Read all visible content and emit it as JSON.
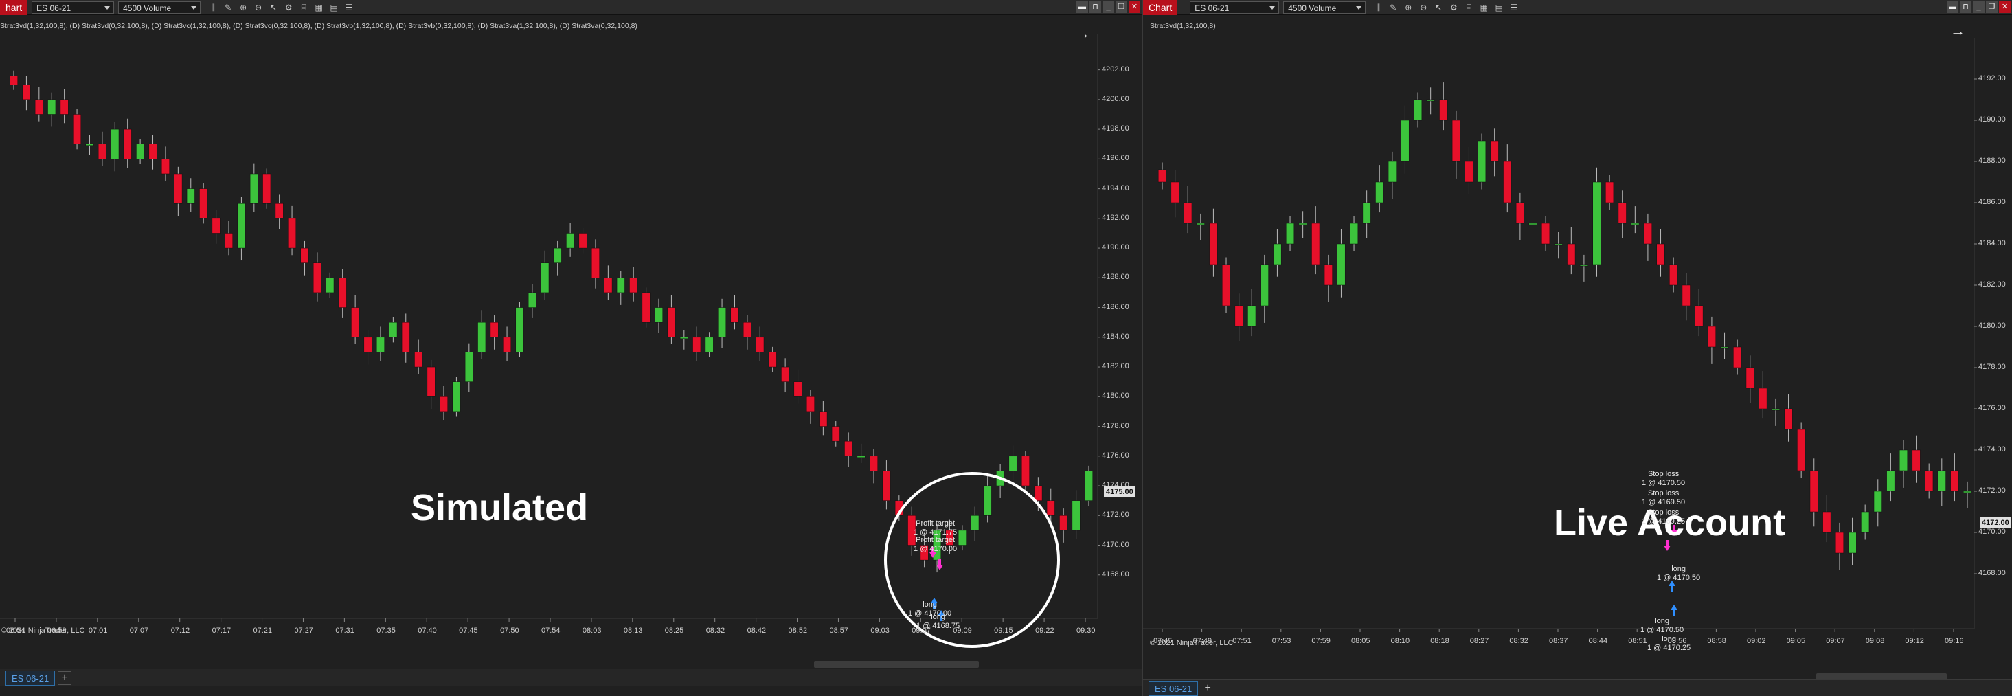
{
  "left": {
    "toolbar": {
      "chart_label": "hart",
      "instrument": "ES 06-21",
      "bar_type": "4500 Volume"
    },
    "indicators": "Strat3vd(1,32,100,8), (D) Strat3vd(0,32,100,8), (D) Strat3vc(1,32,100,8), (D) Strat3vc(0,32,100,8), (D) Strat3vb(1,32,100,8), (D) Strat3vb(0,32,100,8), (D) Strat3va(1,32,100,8), (D) Strat3va(0,32,100,8)",
    "price_labels": [
      "4202.00",
      "4200.00",
      "4198.00",
      "4196.00",
      "4194.00",
      "4192.00",
      "4190.00",
      "4188.00",
      "4186.00",
      "4184.00",
      "4182.00",
      "4180.00",
      "4178.00",
      "4176.00",
      "4174.00",
      "4172.00",
      "4170.00",
      "4168.00"
    ],
    "current_price": "4175.00",
    "time_labels": [
      "06:54",
      "06:58",
      "07:01",
      "07:07",
      "07:12",
      "07:17",
      "07:21",
      "07:27",
      "07:31",
      "07:35",
      "07:40",
      "07:45",
      "07:50",
      "07:54",
      "08:03",
      "08:13",
      "08:25",
      "08:32",
      "08:42",
      "08:52",
      "08:57",
      "09:03",
      "09:07",
      "09:09",
      "09:15",
      "09:22",
      "09:30"
    ],
    "copyright": "© 2021 NinjaTrader, LLC",
    "overlay_text": "Simulated",
    "annotations": [
      {
        "text": "Profit target\n1 @ 4171.75"
      },
      {
        "text": "Profit target\n1 @ 4170.00"
      },
      {
        "text": "long\n1 @ 4170.00"
      },
      {
        "text": "long\n1 @ 4168.75"
      }
    ],
    "tab_label": "ES 06-21",
    "add_tab": "+"
  },
  "right": {
    "toolbar": {
      "chart_label": "Chart",
      "instrument": "ES 06-21",
      "bar_type": "4500 Volume"
    },
    "indicators": "Strat3vd(1,32,100,8)",
    "price_labels": [
      "4192.00",
      "4190.00",
      "4188.00",
      "4186.00",
      "4184.00",
      "4182.00",
      "4180.00",
      "4178.00",
      "4176.00",
      "4174.00",
      "4172.00",
      "4170.00",
      "4168.00"
    ],
    "current_price": "4172.00",
    "time_labels": [
      "07:45",
      "07:49",
      "07:51",
      "07:53",
      "07:59",
      "08:05",
      "08:10",
      "08:18",
      "08:27",
      "08:32",
      "08:37",
      "08:44",
      "08:51",
      "08:56",
      "08:58",
      "09:02",
      "09:05",
      "09:07",
      "09:08",
      "09:12",
      "09:16"
    ],
    "copyright": "© 2021 NinjaTrader, LLC",
    "overlay_text": "Live Account",
    "annotations": [
      {
        "text": "Stop loss\n1 @ 4170.50"
      },
      {
        "text": "Stop loss\n1 @ 4169.50"
      },
      {
        "text": "Stop loss\n1 @ 4169.25"
      },
      {
        "text": "long\n1 @ 4170.50"
      },
      {
        "text": "long\n1 @ 4170.50"
      },
      {
        "text": "long\n1 @ 4170.25"
      }
    ],
    "tab_label": "ES 06-21",
    "add_tab": "+"
  },
  "colors": {
    "up": "#3cc43c",
    "down": "#e8102a",
    "background": "#202020",
    "entry_arrow": "#2f8fff",
    "exit_arrow": "#ff30d0"
  },
  "chart_data": [
    {
      "type": "candlestick",
      "title": "Simulated",
      "ylim": [
        4166,
        4203
      ],
      "close_series": [
        4201,
        4200,
        4199,
        4200,
        4199,
        4197,
        4197,
        4196,
        4198,
        4196,
        4197,
        4196,
        4195,
        4193,
        4194,
        4192,
        4191,
        4190,
        4193,
        4195,
        4193,
        4192,
        4190,
        4189,
        4187,
        4188,
        4186,
        4184,
        4183,
        4184,
        4185,
        4183,
        4182,
        4180,
        4179,
        4181,
        4183,
        4185,
        4184,
        4183,
        4186,
        4187,
        4189,
        4190,
        4191,
        4190,
        4188,
        4187,
        4188,
        4187,
        4185,
        4186,
        4184,
        4184,
        4183,
        4184,
        4186,
        4185,
        4184,
        4183,
        4182,
        4181,
        4180,
        4179,
        4178,
        4177,
        4176,
        4176,
        4175,
        4173,
        4172,
        4170,
        4169,
        4171,
        4170,
        4171,
        4172,
        4174,
        4175,
        4176,
        4174,
        4173,
        4172,
        4171,
        4173,
        4175
      ]
    },
    {
      "type": "candlestick",
      "title": "Live Account",
      "ylim": [
        4166,
        4193
      ],
      "close_series": [
        4187,
        4186,
        4185,
        4185,
        4183,
        4181,
        4180,
        4181,
        4183,
        4184,
        4185,
        4185,
        4183,
        4182,
        4184,
        4185,
        4186,
        4187,
        4188,
        4190,
        4191,
        4191,
        4190,
        4188,
        4187,
        4189,
        4188,
        4186,
        4185,
        4185,
        4184,
        4184,
        4183,
        4183,
        4187,
        4186,
        4185,
        4185,
        4184,
        4183,
        4182,
        4181,
        4180,
        4179,
        4179,
        4178,
        4177,
        4176,
        4176,
        4175,
        4173,
        4171,
        4170,
        4169,
        4170,
        4171,
        4172,
        4173,
        4174,
        4173,
        4172,
        4173,
        4172,
        4172
      ]
    }
  ]
}
